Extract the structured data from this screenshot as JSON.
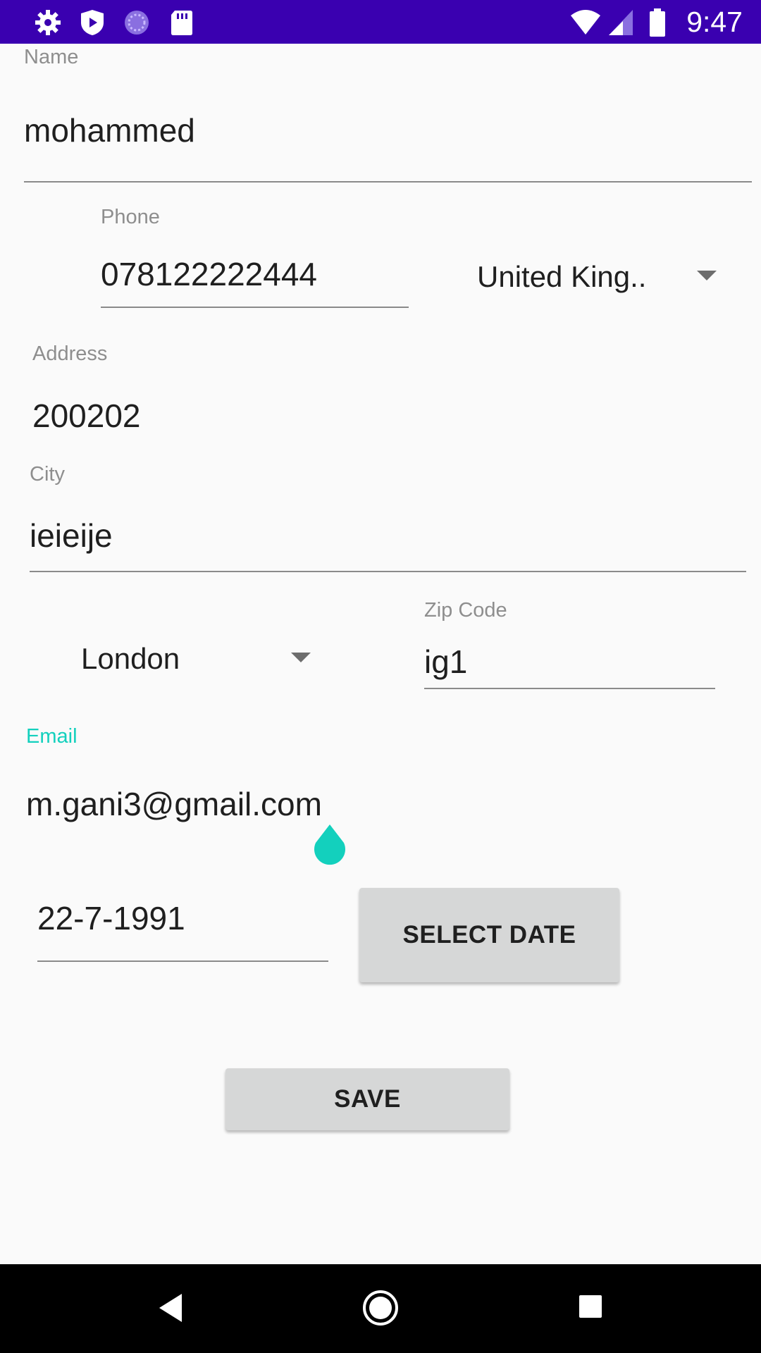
{
  "status_bar": {
    "time": "9:47",
    "left_icons": [
      "gear-icon",
      "shield-play-icon",
      "sync-circle-icon",
      "sd-card-icon"
    ],
    "right_icons": [
      "wifi-icon",
      "cell-signal-icon",
      "battery-icon"
    ]
  },
  "form": {
    "name": {
      "label": "Name",
      "value": "mohammed"
    },
    "phone": {
      "label": "Phone",
      "value": "078122222444"
    },
    "country": {
      "selected": "United King.."
    },
    "address": {
      "label": "Address",
      "value": "200202"
    },
    "city": {
      "label": "City",
      "value": "ieieije"
    },
    "city_spinner": {
      "selected": "London"
    },
    "zip": {
      "label": "Zip Code",
      "value": "ig1"
    },
    "email": {
      "label": "Email",
      "value": "m.gani3@gmail.com"
    },
    "date": {
      "value": "22-7-1991"
    },
    "select_date_label": "SELECT DATE",
    "save_label": "SAVE"
  },
  "colors": {
    "status_bar": "#3a00b0",
    "accent": "#13d0bd",
    "button": "#d6d7d7"
  },
  "nav_bar": {
    "icons": [
      "back-icon",
      "home-icon",
      "recents-icon"
    ]
  }
}
